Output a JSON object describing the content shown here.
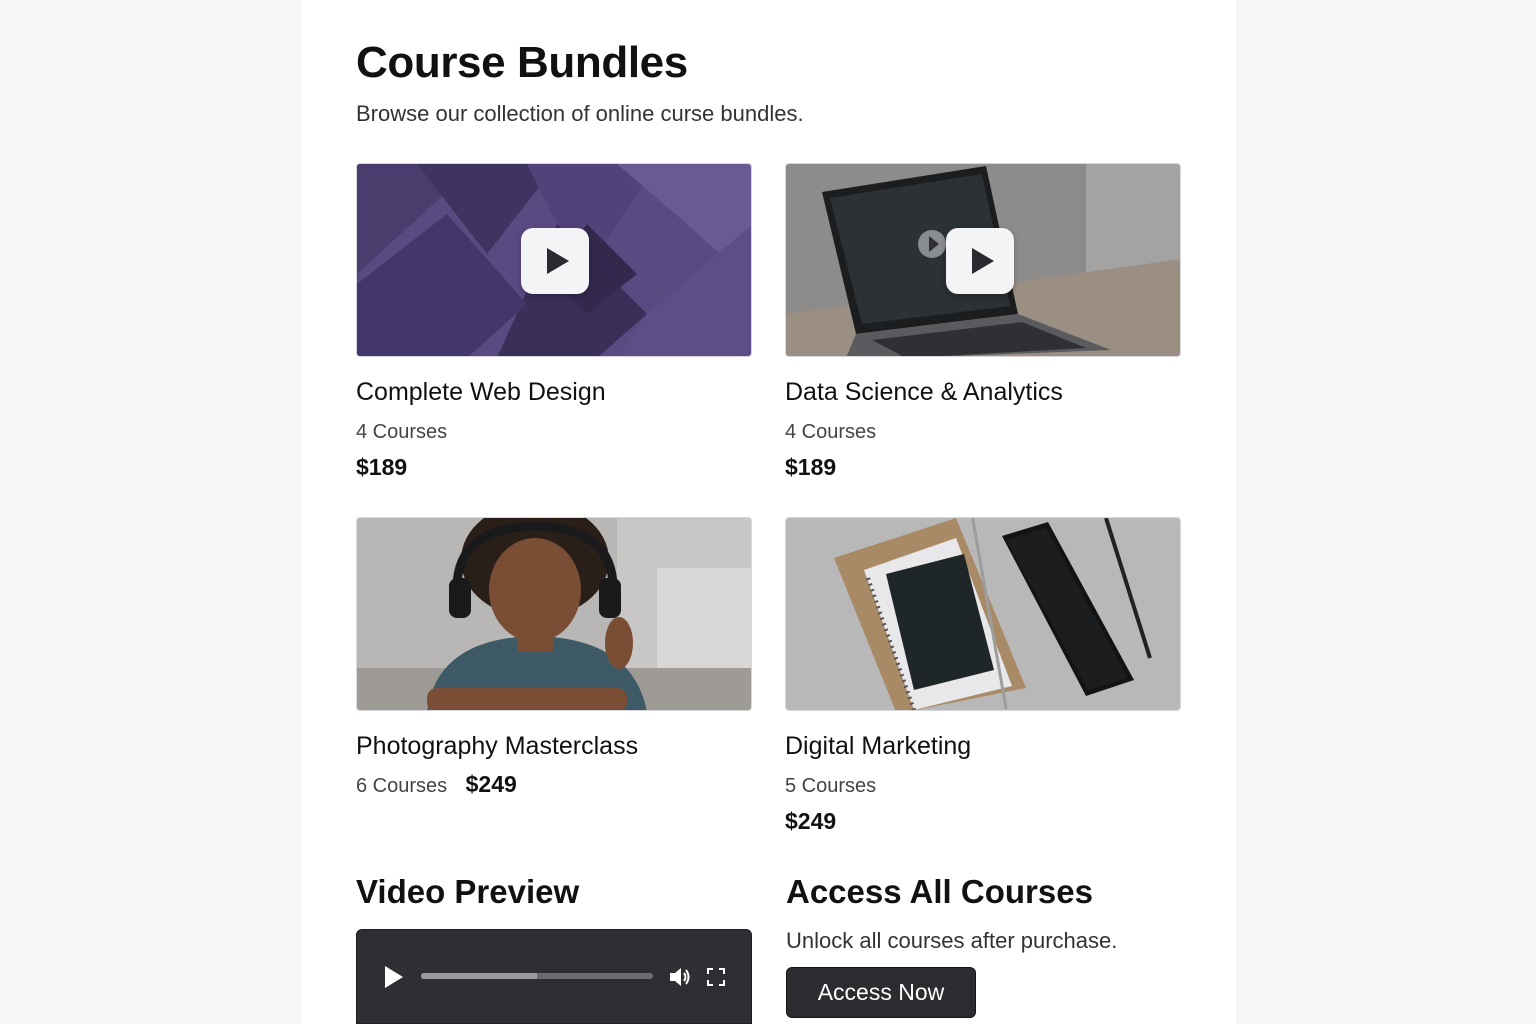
{
  "header": {
    "title": "Course Bundles",
    "subtitle": "Browse our collection of online curse bundles."
  },
  "bundles": [
    {
      "title": "Complete Web Design",
      "count": "4 Courses",
      "price": "$189",
      "thumbnail": "purple-geometric-video"
    },
    {
      "title": "Data Science & Analytics",
      "count": "4 Courses",
      "price": "$189",
      "thumbnail": "laptop-video"
    },
    {
      "title": "Photography Masterclass",
      "count": "6 Courses",
      "price": "$249",
      "thumbnail": "woman-headphones-photo"
    },
    {
      "title": "Digital Marketing",
      "count": "5 Courses",
      "price": "$249",
      "thumbnail": "notebook-phone-photo"
    }
  ],
  "video_preview": {
    "title": "Video Preview",
    "progress": 0.5
  },
  "access": {
    "title": "Access All Courses",
    "text": "Unlock all courses after purchase.",
    "button_label": "Access Now"
  }
}
